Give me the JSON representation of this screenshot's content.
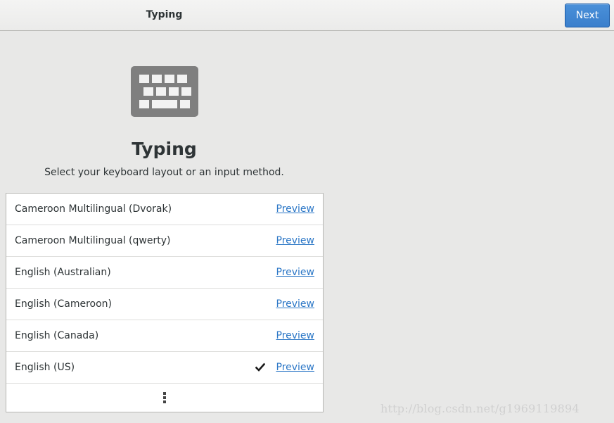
{
  "header": {
    "title": "Typing",
    "next_label": "Next"
  },
  "main": {
    "icon": "keyboard-icon",
    "title": "Typing",
    "subtitle": "Select your keyboard layout or an input method."
  },
  "layouts": [
    {
      "name": "Cameroon Multilingual (Dvorak)",
      "preview_label": "Preview",
      "selected": false
    },
    {
      "name": "Cameroon Multilingual (qwerty)",
      "preview_label": "Preview",
      "selected": false
    },
    {
      "name": "English (Australian)",
      "preview_label": "Preview",
      "selected": false
    },
    {
      "name": "English (Cameroon)",
      "preview_label": "Preview",
      "selected": false
    },
    {
      "name": "English (Canada)",
      "preview_label": "Preview",
      "selected": false
    },
    {
      "name": "English (US)",
      "preview_label": "Preview",
      "selected": true
    }
  ],
  "more_icon": "view-more-icon",
  "watermark": "http://blog.csdn.net/g1969119894",
  "colors": {
    "accent": "#3a7fcc",
    "link": "#2a76c6",
    "background": "#e8e8e7"
  }
}
